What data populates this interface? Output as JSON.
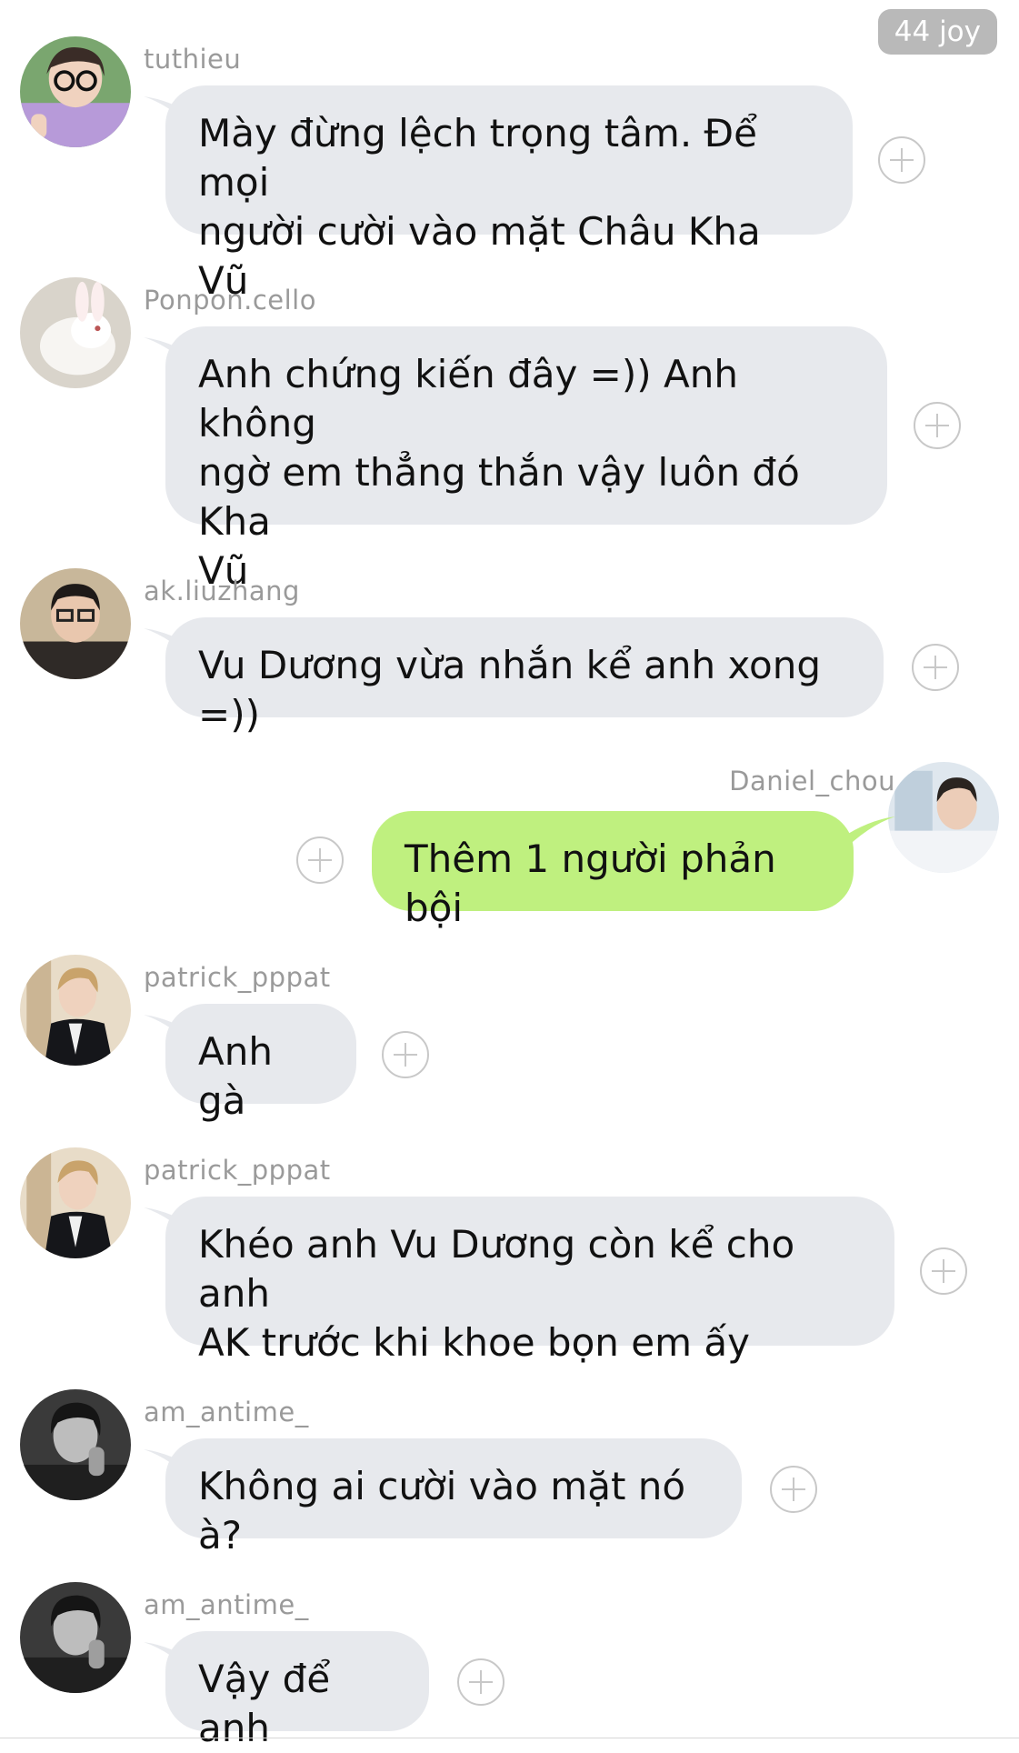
{
  "header": {
    "reaction_badge": "44 joy"
  },
  "messages": [
    {
      "user": "tuthieu",
      "avatar": "girl-with-glasses-avatar",
      "side": "left",
      "lines": [
        "Mày đừng lệch trọng tâm. Để mọi",
        "người cười vào mặt Châu Kha Vũ"
      ]
    },
    {
      "user": "Ponpon.cello",
      "avatar": "white-rabbit-avatar",
      "side": "left",
      "lines": [
        "Anh chứng kiến đây =)) Anh không",
        "ngờ em thẳng thắn vậy luôn đó Kha",
        "Vũ"
      ]
    },
    {
      "user": "ak.liuzhang",
      "avatar": "boy-with-glasses-avatar",
      "side": "left",
      "lines": [
        "Vu Dương vừa nhắn kể anh xong =))"
      ]
    },
    {
      "user": "Daniel_chou",
      "avatar": "boy-by-window-avatar",
      "side": "right",
      "lines": [
        "Thêm 1 người phản bội"
      ]
    },
    {
      "user": "patrick_pppat",
      "avatar": "boy-in-black-jacket-avatar",
      "side": "left",
      "lines": [
        "Anh gà"
      ]
    },
    {
      "user": "patrick_pppat",
      "avatar": "boy-in-black-jacket-avatar",
      "side": "left",
      "lines": [
        "Khéo anh Vu Dương còn kể cho anh",
        "AK trước khi khoe bọn em ấy"
      ]
    },
    {
      "user": "am_antime_",
      "avatar": "monochrome-portrait-avatar",
      "side": "left",
      "lines": [
        "Không ai cười vào mặt nó à?"
      ]
    },
    {
      "user": "am_antime_",
      "avatar": "monochrome-portrait-avatar",
      "side": "left",
      "lines": [
        "Vậy để anh"
      ]
    }
  ],
  "colors": {
    "incoming_bubble": "#e7e9ed",
    "outgoing_bubble": "#bff07f",
    "username": "#9a9a9a",
    "badge": "#b9b9b9"
  }
}
